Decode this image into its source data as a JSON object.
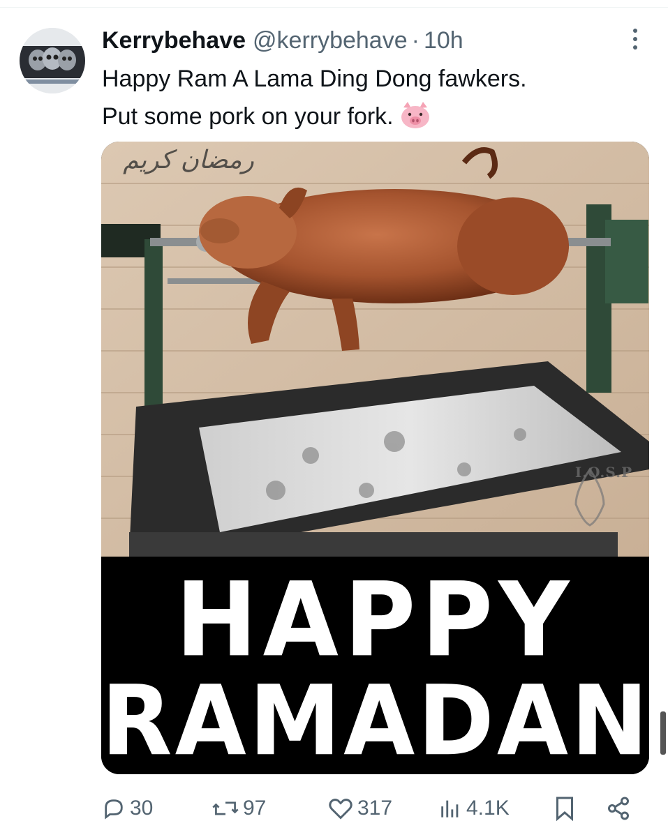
{
  "tweet": {
    "display_name": "Kerrybehave",
    "handle": "@kerrybehave",
    "separator": "·",
    "time": "10h",
    "text_line1": "Happy Ram A Lama Ding Dong fawkers.",
    "text_line2": "Put some pork on your fork.",
    "emoji": "pig-face-icon",
    "more_icon": "more-vertical-icon"
  },
  "media": {
    "arabic_text": "رمضان كريم",
    "watermark": "I.O.S.P",
    "caption_line1": "HAPPY",
    "caption_line2": "RAMADAN!"
  },
  "actions": {
    "replies": "30",
    "reposts": "97",
    "likes": "317",
    "views": "4.1K",
    "reply_icon": "reply-icon",
    "repost_icon": "repost-icon",
    "like_icon": "heart-icon",
    "views_icon": "views-chart-icon",
    "bookmark_icon": "bookmark-icon",
    "share_icon": "share-icon"
  },
  "colors": {
    "text_primary": "#0f1419",
    "text_secondary": "#536471",
    "divider": "#eff3f4",
    "banner_bg": "#000000"
  }
}
